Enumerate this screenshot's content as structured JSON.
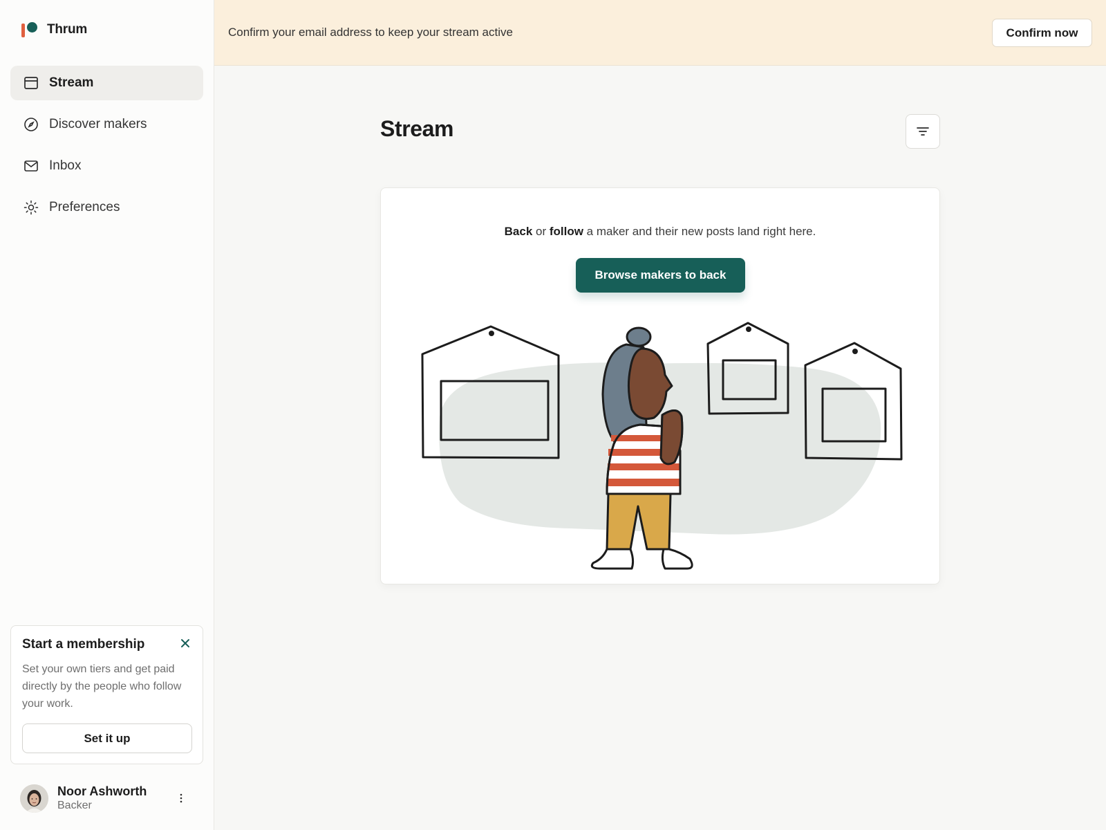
{
  "app": {
    "name": "Thrum",
    "brand_colors": {
      "bar": "#e0603f",
      "dot": "#175f58"
    }
  },
  "sidebar": {
    "items": [
      {
        "label": "Stream",
        "icon": "stream-icon",
        "active": true
      },
      {
        "label": "Discover makers",
        "icon": "compass-icon",
        "active": false
      },
      {
        "label": "Inbox",
        "icon": "mail-icon",
        "active": false
      },
      {
        "label": "Preferences",
        "icon": "sun-gear-icon",
        "active": false
      }
    ]
  },
  "promo": {
    "title": "Start a membership",
    "body": "Set your own tiers and get paid directly by the people who follow your work.",
    "button": "Set it up",
    "close_icon": "close-icon"
  },
  "user": {
    "name": "Noor Ashworth",
    "role": "Backer",
    "menu_icon": "more-vertical-icon"
  },
  "banner": {
    "text": "Confirm your email address to keep your stream active",
    "button": "Confirm now"
  },
  "main": {
    "title": "Stream",
    "filter_icon": "filter-icon",
    "empty_state": {
      "msg_bold_1": "Back",
      "msg_mid_1": " or ",
      "msg_bold_2": "follow",
      "msg_rest": " a maker and their new posts land right here.",
      "cta": "Browse makers to back"
    }
  },
  "colors": {
    "accent": "#175f58",
    "banner_bg": "#fbefdc",
    "stripe": "#d4583a",
    "pants": "#d9a84a",
    "hair": "#6d7e8c",
    "skin": "#7a4a33",
    "blob": "#e4e8e5"
  }
}
